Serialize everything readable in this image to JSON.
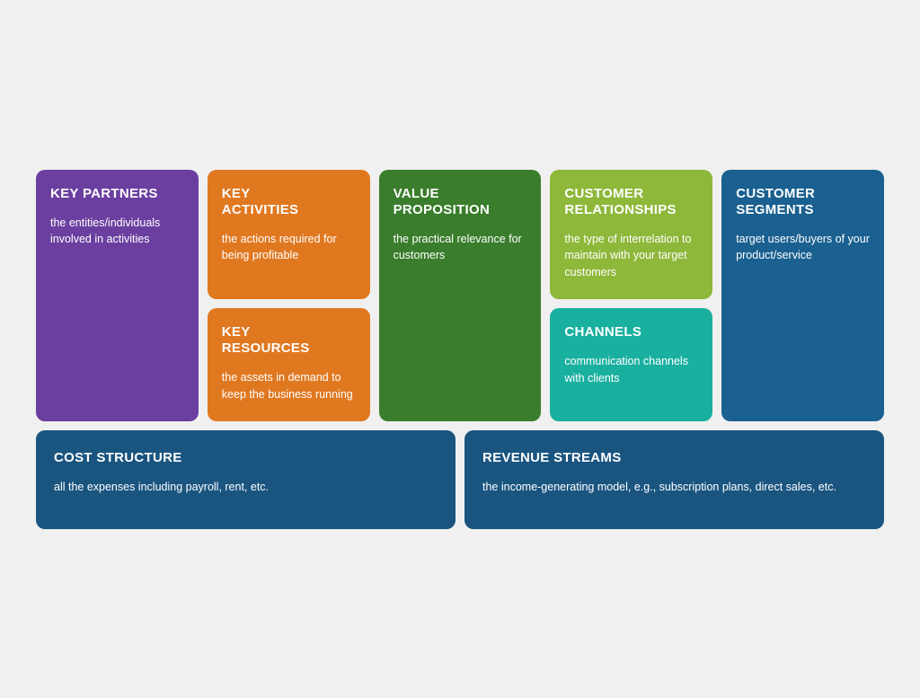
{
  "cards": {
    "key_partners": {
      "title": "KEY\nPARTNERS",
      "desc": "the entities/individuals involved in activities",
      "color": "purple"
    },
    "key_activities": {
      "title": "KEY\nACTIVITIES",
      "desc": "the actions required for being profitable",
      "color": "orange"
    },
    "value_proposition": {
      "title": "VALUE\nPROPOSITION",
      "desc": "the practical relevance for customers",
      "color": "green-dark"
    },
    "customer_relationships": {
      "title": "CUSTOMER\nRELATIONSHIPS",
      "desc": "the type of interrelation to maintain with your target customers",
      "color": "green-light"
    },
    "customer_segments": {
      "title": "CUSTOMER\nSEGMENTS",
      "desc": "target users/buyers of your product/service",
      "color": "blue-dark"
    },
    "key_resources": {
      "title": "KEY\nRESOURCES",
      "desc": "the assets in demand to keep the business running",
      "color": "orange"
    },
    "channels": {
      "title": "CHANNELS",
      "desc": "communication channels with clients",
      "color": "teal"
    },
    "cost_structure": {
      "title": "COST STRUCTURE",
      "desc": "all the expenses including payroll, rent, etc.",
      "color": "blue-bottom"
    },
    "revenue_streams": {
      "title": "REVENUE STREAMS",
      "desc": "the income-generating model, e.g., subscription plans, direct sales, etc.",
      "color": "blue-bottom"
    }
  }
}
